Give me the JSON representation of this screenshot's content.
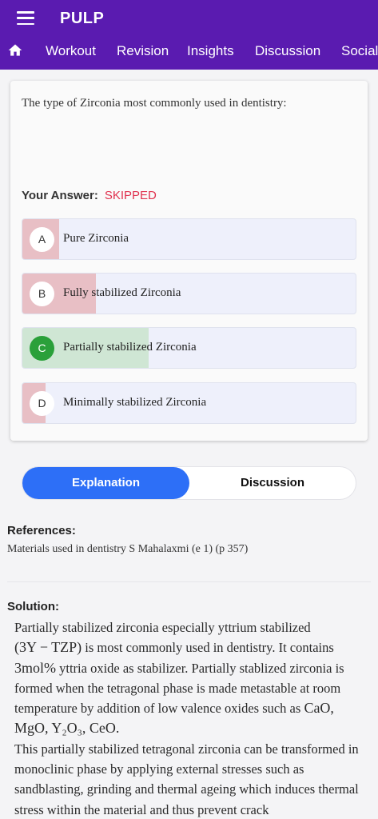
{
  "app": {
    "title": "PULP"
  },
  "nav": {
    "items": [
      "Workout",
      "Revision",
      "Insights",
      "Discussion",
      "Social"
    ]
  },
  "question": {
    "text": "The type of Zirconia most commonly used in dentistry:"
  },
  "answer": {
    "label": "Your Answer:",
    "status": "SKIPPED"
  },
  "options": [
    {
      "letter": "A",
      "text": "Pure Zirconia",
      "percent": 11,
      "correct": false
    },
    {
      "letter": "B",
      "text": "Fully stabilized Zirconia",
      "percent": 22,
      "correct": false
    },
    {
      "letter": "C",
      "text": "Partially stabilized Zirconia",
      "percent": 38,
      "correct": true
    },
    {
      "letter": "D",
      "text": "Minimally stabilized Zirconia",
      "percent": 7,
      "correct": false
    }
  ],
  "tabs": {
    "explanation": "Explanation",
    "discussion": "Discussion"
  },
  "references": {
    "heading": "References:",
    "text": "Materials used in dentistry S Mahalaxmi (e 1) (p 357)"
  },
  "solution": {
    "heading": "Solution:",
    "p1": "Partially stabilized zirconia especially yttrium stabilized",
    "m1": "(3Y − TZP)",
    "p2": " is most commonly used in dentistry. It contains ",
    "m2": "3mol%",
    "p3": " yttria oxide as stabilizer. Partially stablized zirconia is formed when the tetragonal phase is made metastable at room temperature by addition of low valence oxides such as ",
    "m3": "CaO, MgO, Y₂O₃, CeO.",
    "p4": "This partially stabilized tetragonal zirconia can be transformed in monoclinic phase by applying external stresses such as sandblasting, grinding and thermal ageing which induces thermal stress within the material and thus prevent crack"
  },
  "colors": {
    "header": "#5a1bb0",
    "accent": "#2d6ff7",
    "wrong_fill": "#e8bfc5",
    "correct_fill": "#cfe6d4",
    "skipped": "#e0314e"
  }
}
